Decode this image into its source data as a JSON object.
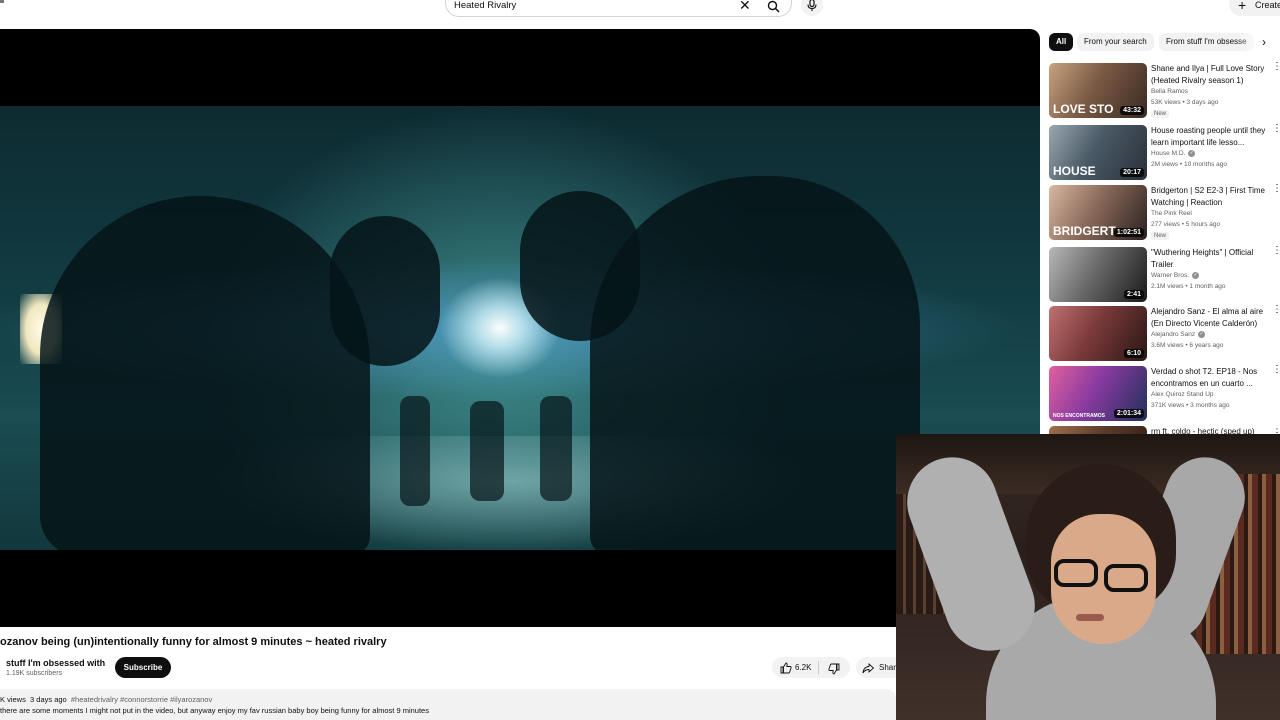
{
  "search": {
    "query": "Heated Rivalry"
  },
  "header": {
    "create_label": "Create"
  },
  "video": {
    "title": "ozanov being (un)intentionally funny for almost 9 minutes ~ heated rivalry",
    "channel": "stuff I'm obsessed with",
    "subscribers": "1.19K subscribers",
    "subscribe_label": "Subscribe",
    "likes": "6.2K",
    "share_label": "Shar",
    "views": "K views",
    "age": "3 days ago",
    "hashtags": "#heatedrivalry #connorstorrie #ilyarozanov",
    "description": "there are some moments I might not put in the video, but anyway enjoy my fav russian baby boy being funny for almost 9 minutes"
  },
  "chips": [
    "All",
    "From your search",
    "From stuff I'm obsesse"
  ],
  "recommendations": [
    {
      "title": "Shane and Ilya | Full Love Story (Heated Rivalry season 1)",
      "channel": "Bella Ramos",
      "verified": false,
      "meta": "53K views • 3 days ago",
      "new": "New",
      "duration": "43:32",
      "thumb_text": "LOVE STO",
      "colors": [
        "#7a5a45",
        "#3a2a22",
        "#c9a27e"
      ]
    },
    {
      "title": "House roasting people until they learn important life lesso...",
      "channel": "House M.D.",
      "verified": true,
      "meta": "2M views • 10 months ago",
      "new": "",
      "duration": "20:17",
      "thumb_text": "HOUSE",
      "colors": [
        "#4a5a66",
        "#2a3038",
        "#9aa8b0"
      ]
    },
    {
      "title": "Bridgerton | S2 E2-3 | First Time Watching | Reaction",
      "channel": "The Pink Reel",
      "verified": false,
      "meta": "277 views • 5 hours ago",
      "new": "New",
      "duration": "1:02:51",
      "thumb_text": "BRIDGERT",
      "colors": [
        "#8a6a5a",
        "#2a2020",
        "#d8b8a0"
      ]
    },
    {
      "title": "\"Wuthering Heights\" | Official Trailer",
      "channel": "Warner Bros.",
      "verified": true,
      "meta": "2.1M views • 1 month ago",
      "new": "",
      "duration": "2:41",
      "thumb_text": "",
      "colors": [
        "#6a6a6a",
        "#1a1a1a",
        "#b8b8b8"
      ]
    },
    {
      "title": "Alejandro Sanz - El alma al aire (En Directo Vicente Calderón)",
      "channel": "Alejandro Sanz",
      "verified": true,
      "meta": "3.6M views • 6 years ago",
      "new": "",
      "duration": "6:10",
      "thumb_text": "",
      "colors": [
        "#7a3a3a",
        "#2a1515",
        "#c07070"
      ]
    },
    {
      "title": "Verdad o shot T2. EP18 - Nos encontramos en un cuarto ...",
      "channel": "Alex Quiroz Stand Up",
      "verified": false,
      "meta": "371K views • 3 months ago",
      "new": "",
      "duration": "2:01:34",
      "thumb_text": "NOS ENCONTRAMOS",
      "colors": [
        "#8a3aa0",
        "#20305a",
        "#e060a0"
      ]
    },
    {
      "title": "rm ft. coldo - hectic (sped up)",
      "channel": "",
      "verified": false,
      "meta": "",
      "new": "",
      "duration": "",
      "thumb_text": "",
      "colors": [
        "#5a3a2a",
        "#2a1a12",
        "#a07050"
      ]
    }
  ]
}
